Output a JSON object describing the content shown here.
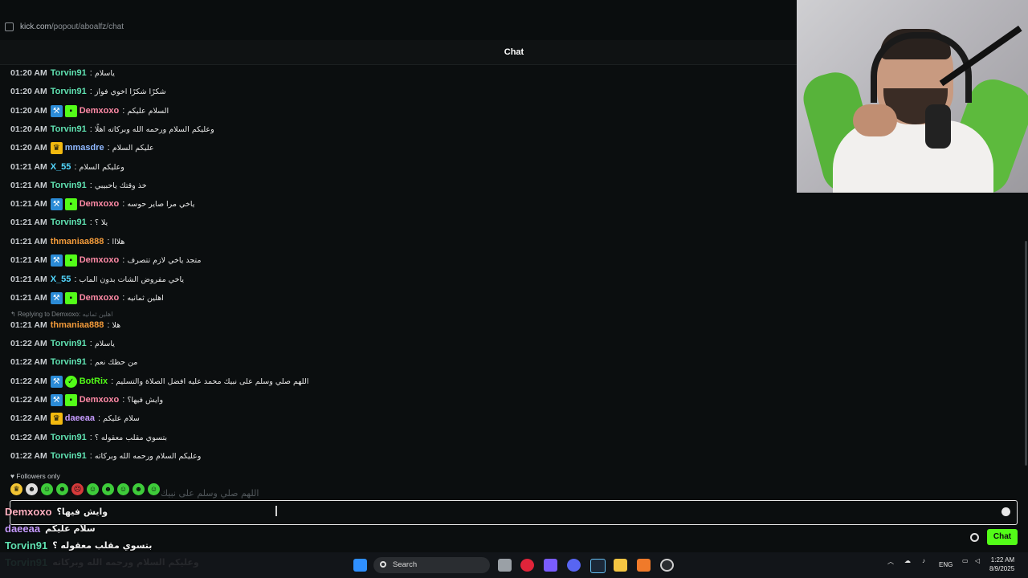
{
  "browser": {
    "url_host": "kick.com",
    "url_path": "/popout/aboalfz/chat"
  },
  "header": {
    "title": "Chat"
  },
  "messages": [
    {
      "time": "01:20 AM",
      "user": "Torvin91",
      "color": "#5fe0b0",
      "badges": [],
      "text": "ياسلام"
    },
    {
      "time": "01:20 AM",
      "user": "Torvin91",
      "color": "#5fe0b0",
      "badges": [],
      "text": "شكرًا شكرًا اخوي فواز"
    },
    {
      "time": "01:20 AM",
      "user": "Demxoxo",
      "color": "#ff8aa6",
      "badges": [
        "mod",
        "sub"
      ],
      "text": "السلام عليكم"
    },
    {
      "time": "01:20 AM",
      "user": "Torvin91",
      "color": "#5fe0b0",
      "badges": [],
      "text": "وعليكم السلام ورحمه الله وبركاته اهلًا"
    },
    {
      "time": "01:20 AM",
      "user": "mmasdre",
      "color": "#8fb8ff",
      "badges": [
        "vip"
      ],
      "text": "عليكم السلام"
    },
    {
      "time": "01:21 AM",
      "user": "X_55",
      "color": "#53d8ff",
      "badges": [],
      "text": "وعليكم السلام"
    },
    {
      "time": "01:21 AM",
      "user": "Torvin91",
      "color": "#5fe0b0",
      "badges": [],
      "text": "خذ وقتك ياحبيبي"
    },
    {
      "time": "01:21 AM",
      "user": "Demxoxo",
      "color": "#ff8aa6",
      "badges": [
        "mod",
        "sub"
      ],
      "text": "ياخي مرا صاير حوسه"
    },
    {
      "time": "01:21 AM",
      "user": "Torvin91",
      "color": "#5fe0b0",
      "badges": [],
      "text": "يلا ؟"
    },
    {
      "time": "01:21 AM",
      "user": "thmaniaa888",
      "color": "#f29a3a",
      "badges": [],
      "text": "هلااا"
    },
    {
      "time": "01:21 AM",
      "user": "Demxoxo",
      "color": "#ff8aa6",
      "badges": [
        "mod",
        "sub"
      ],
      "text": "متجد ياخي لازم تتصرف"
    },
    {
      "time": "01:21 AM",
      "user": "X_55",
      "color": "#53d8ff",
      "badges": [],
      "text": "ياخي مفروض الشات بدون الماب"
    },
    {
      "time": "01:21 AM",
      "user": "Demxoxo",
      "color": "#ff8aa6",
      "badges": [
        "mod",
        "sub"
      ],
      "text": "اهلين ثمانيه"
    },
    {
      "time": "01:21 AM",
      "user": "thmaniaa888",
      "color": "#f29a3a",
      "badges": [],
      "text": "هلا"
    },
    {
      "time": "01:22 AM",
      "user": "Torvin91",
      "color": "#5fe0b0",
      "badges": [],
      "text": "ياسلام"
    },
    {
      "time": "01:22 AM",
      "user": "Torvin91",
      "color": "#5fe0b0",
      "badges": [],
      "text": "من حظك نعم"
    },
    {
      "time": "01:22 AM",
      "user": "BotRix",
      "color": "#53fc18",
      "badges": [
        "mod",
        "verified"
      ],
      "text": "اللهم صلي وسلم على نبيك محمد عليه افضل الصلاة والتسليم"
    },
    {
      "time": "01:22 AM",
      "user": "Demxoxo",
      "color": "#ff8aa6",
      "badges": [
        "mod",
        "sub"
      ],
      "text": "وايش فيها؟"
    },
    {
      "time": "01:22 AM",
      "user": "daeeaa",
      "color": "#c79cff",
      "badges": [
        "vip"
      ],
      "text": "سلام عليكم"
    },
    {
      "time": "01:22 AM",
      "user": "Torvin91",
      "color": "#5fe0b0",
      "badges": [],
      "text": "بتسوي مقلب معقوله ؟"
    },
    {
      "time": "01:22 AM",
      "user": "Torvin91",
      "color": "#5fe0b0",
      "badges": [],
      "text": "وعليكم السلام ورحمه الله وبركاته"
    }
  ],
  "reply": {
    "label": "Replying to Demxoxo:",
    "quote": "اهلين ثمانيه"
  },
  "followers_only": "Followers only",
  "ghost_text": "اللهم صلي وسلم على نبيك",
  "overlay": [
    {
      "user": "Demxoxo",
      "color": "#ffb0c0",
      "text": "وايش فيها؟"
    },
    {
      "user": "daeeaa",
      "color": "#c79cff",
      "text": "سلام عليكم"
    },
    {
      "user": "Torvin91",
      "color": "#5fe0b0",
      "text": "بتسوي مقلب معقوله ؟"
    },
    {
      "user": "Torvin91",
      "color": "#5fe0b0",
      "text": "وعليكم السلام ورحمه الله وبركاته"
    }
  ],
  "chat_button": "Chat",
  "taskbar": {
    "search_label": "Search",
    "language": "ENG",
    "time": "1:22 AM",
    "date": "8/9/2025"
  }
}
